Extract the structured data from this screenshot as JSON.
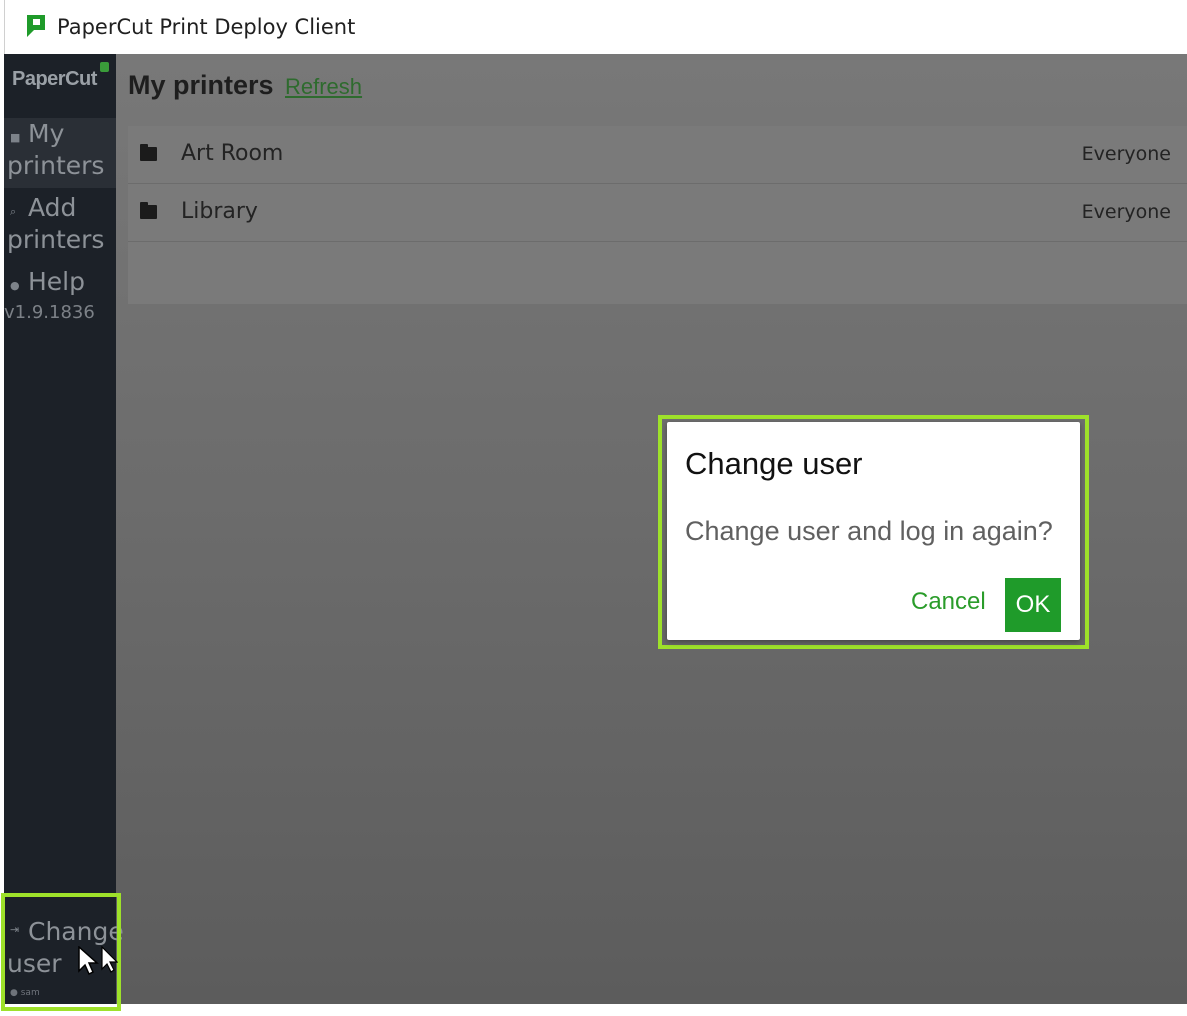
{
  "window": {
    "title": "PaperCut Print Deploy Client",
    "logo_icon": "papercut-logo-icon",
    "accent": "#1f9b2a"
  },
  "sidebar": {
    "brand": "PaperCut",
    "items": [
      {
        "icon": "folder-icon",
        "label_line1": "My",
        "label_line2": "printers",
        "active": true
      },
      {
        "icon": "search-icon",
        "label_line1": "Add",
        "label_line2": "printers",
        "active": false
      },
      {
        "icon": "help-icon",
        "label_line1": "Help",
        "active": false
      }
    ],
    "version": "v1.9.1836",
    "change_user": {
      "icon": "sign-out-icon",
      "label_line1": "Change",
      "label_line2": "user"
    },
    "user": {
      "icon": "user-icon",
      "name": "sam"
    }
  },
  "main": {
    "title": "My printers",
    "refresh_label": "Refresh",
    "printers": [
      {
        "name": "Art Room",
        "access": "Everyone",
        "icon": "printer-icon"
      },
      {
        "name": "Library",
        "access": "Everyone",
        "icon": "printer-icon"
      }
    ]
  },
  "dialog": {
    "title": "Change user",
    "message": "Change user and log in again?",
    "cancel_label": "Cancel",
    "ok_label": "OK"
  }
}
